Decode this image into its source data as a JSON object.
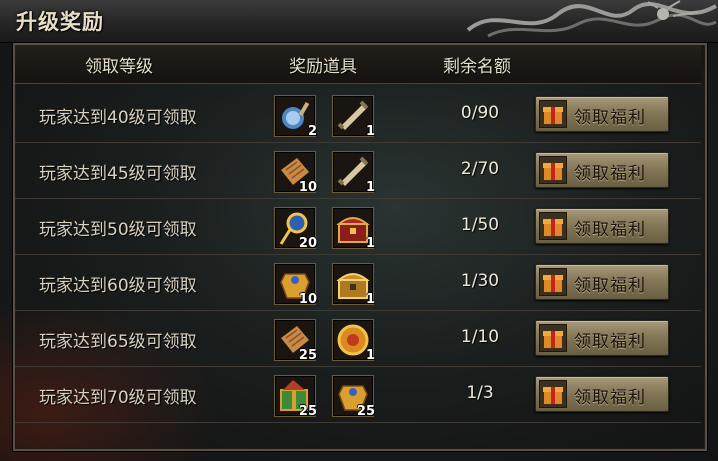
{
  "title": "升级奖励",
  "columns": {
    "level": "领取等级",
    "items": "奖励道具",
    "remaining": "剩余名额"
  },
  "button_label": "领取福利",
  "rows": [
    {
      "requirement": "玩家达到40级可领取",
      "items": [
        {
          "icon": "potion-flask-icon",
          "qty": "2"
        },
        {
          "icon": "scroll-icon",
          "qty": "1"
        }
      ],
      "remaining": "0/90"
    },
    {
      "requirement": "玩家达到45级可领取",
      "items": [
        {
          "icon": "parchment-icon",
          "qty": "10"
        },
        {
          "icon": "scroll-icon",
          "qty": "1"
        }
      ],
      "remaining": "2/70"
    },
    {
      "requirement": "玩家达到50级可领取",
      "items": [
        {
          "icon": "staff-orb-icon",
          "qty": "20"
        },
        {
          "icon": "red-treasure-chest-icon",
          "qty": "1"
        }
      ],
      "remaining": "1/50"
    },
    {
      "requirement": "玩家达到60级可领取",
      "items": [
        {
          "icon": "gold-armor-icon",
          "qty": "10"
        },
        {
          "icon": "gold-treasure-chest-icon",
          "qty": "1"
        }
      ],
      "remaining": "1/30"
    },
    {
      "requirement": "玩家达到65级可领取",
      "items": [
        {
          "icon": "parchment-icon",
          "qty": "25"
        },
        {
          "icon": "gold-medallion-icon",
          "qty": "1"
        }
      ],
      "remaining": "1/10"
    },
    {
      "requirement": "玩家达到70级可领取",
      "items": [
        {
          "icon": "gift-box-icon",
          "qty": "25"
        },
        {
          "icon": "gold-armor-icon",
          "qty": "25"
        }
      ],
      "remaining": "1/3"
    }
  ]
}
